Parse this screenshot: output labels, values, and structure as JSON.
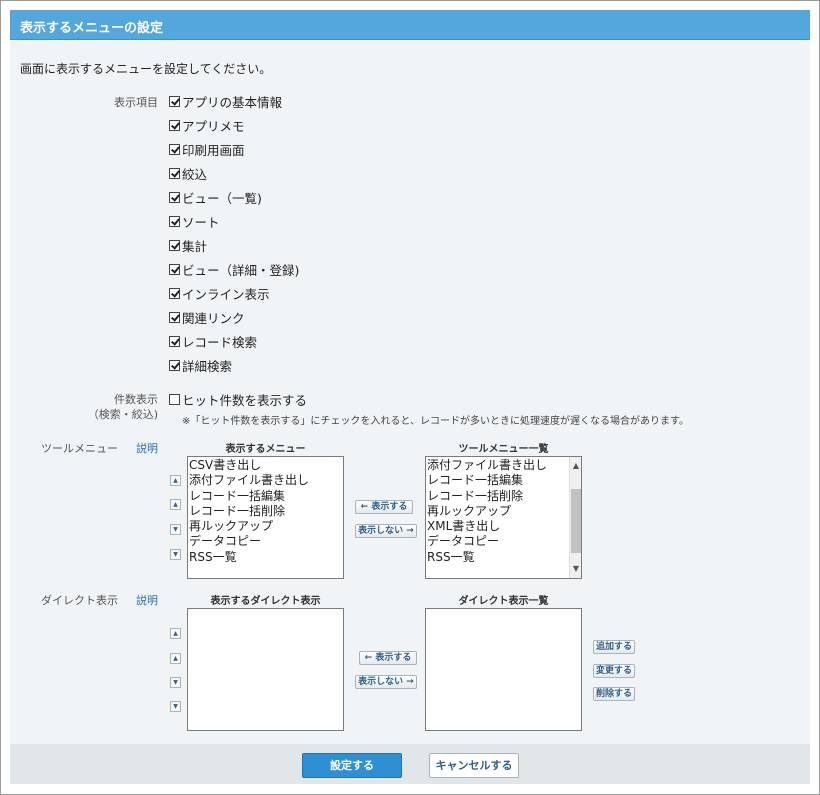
{
  "title": "表示するメニューの設定",
  "description": "画面に表示するメニューを設定してください。",
  "display_items": {
    "label": "表示項目",
    "items": [
      {
        "label": "アプリの基本情報",
        "checked": true
      },
      {
        "label": "アプリメモ",
        "checked": true
      },
      {
        "label": "印刷用画面",
        "checked": true
      },
      {
        "label": "絞込",
        "checked": true
      },
      {
        "label": "ビュー（一覧)",
        "checked": true
      },
      {
        "label": "ソート",
        "checked": true
      },
      {
        "label": "集計",
        "checked": true
      },
      {
        "label": "ビュー（詳細・登録)",
        "checked": true
      },
      {
        "label": "インライン表示",
        "checked": true
      },
      {
        "label": "関連リンク",
        "checked": true
      },
      {
        "label": "レコード検索",
        "checked": true
      },
      {
        "label": "詳細検索",
        "checked": true
      }
    ]
  },
  "count_display": {
    "label_line1": "件数表示",
    "label_line2": "（検索・絞込)",
    "checkbox_label": "ヒット件数を表示する",
    "checked": false,
    "note": "※「ヒット件数を表示する」にチェックを入れると、レコードが多いときに処理速度が遅くなる場合があります。"
  },
  "tool_menu": {
    "label": "ツールメニュー",
    "help_link": "説明",
    "selected_title": "表示するメニュー",
    "selected_items": [
      "CSV書き出し",
      "添付ファイル書き出し",
      "レコード一括編集",
      "レコード一括削除",
      "再ルックアップ",
      "データコピー",
      "RSS一覧"
    ],
    "available_title": "ツールメニュー一覧",
    "available_items": [
      "添付ファイル書き出し",
      "レコード一括編集",
      "レコード一括削除",
      "再ルックアップ",
      "XML書き出し",
      "データコピー",
      "RSS一覧"
    ],
    "show_button": "← 表示する",
    "hide_button": "表示しない →"
  },
  "direct_display": {
    "label": "ダイレクト表示",
    "help_link": "説明",
    "selected_title": "表示するダイレクト表示",
    "available_title": "ダイレクト表示一覧",
    "show_button": "← 表示する",
    "hide_button": "表示しない →",
    "add_button": "追加する",
    "change_button": "変更する",
    "delete_button": "削除する"
  },
  "footer": {
    "submit": "設定する",
    "cancel": "キャンセルする"
  },
  "colors": {
    "accent": "#53a7dc",
    "primary_button": "#2f8fd3",
    "panel_bg": "#f0f4f6"
  }
}
